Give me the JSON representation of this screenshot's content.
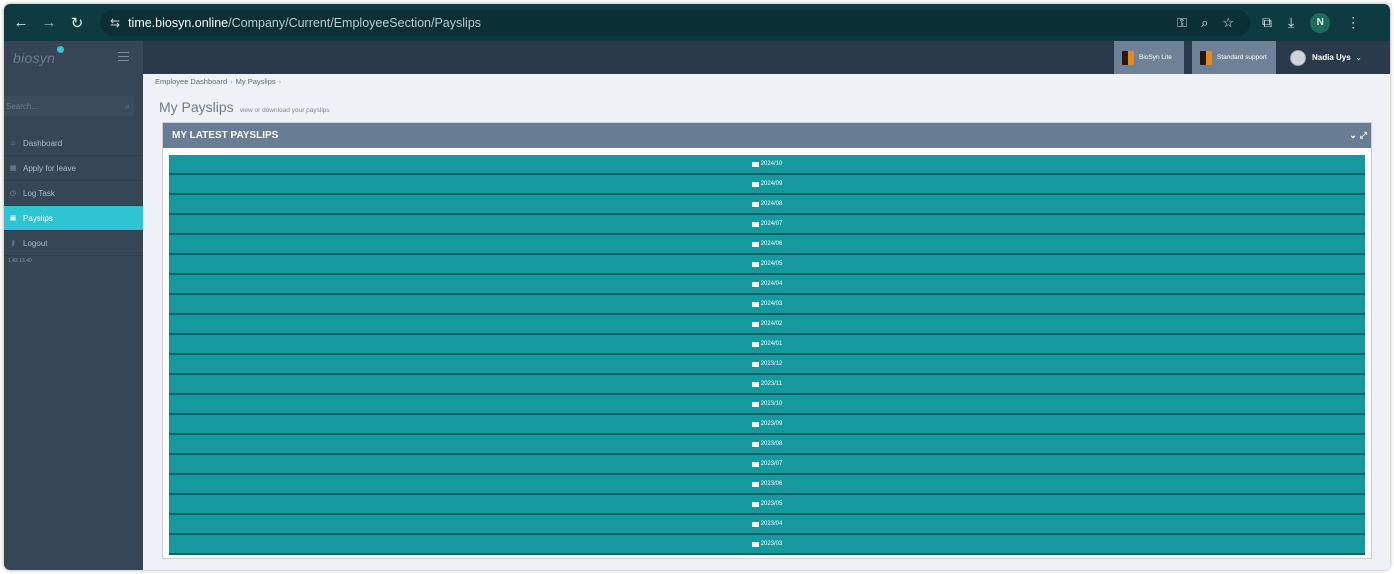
{
  "browser": {
    "url_host": "time.biosyn.online",
    "url_path": "/Company/Current/EmployeeSection/Payslips",
    "profile_initial": "N"
  },
  "header": {
    "logo": "biosyn",
    "buttons": [
      "BioSyn Lite",
      "Standard support"
    ],
    "user_name": "Nadia Uys"
  },
  "sidebar": {
    "search_placeholder": "Search...",
    "items": [
      {
        "label": "Dashboard",
        "icon": "home-icon"
      },
      {
        "label": "Apply for leave",
        "icon": "calendar-icon"
      },
      {
        "label": "Log Task",
        "icon": "clock-icon"
      },
      {
        "label": "Payslips",
        "icon": "payslip-icon",
        "active": true
      },
      {
        "label": "Logout",
        "icon": "key-icon"
      }
    ],
    "version": "1.42.13.40"
  },
  "main": {
    "breadcrumb": [
      "Employee Dashboard",
      "My Payslips"
    ],
    "title": "My Payslips",
    "subtitle": "view or download your payslips",
    "panel_title": "MY LATEST PAYSLIPS",
    "payslips": [
      "2024/10",
      "2024/09",
      "2024/08",
      "2024/07",
      "2024/06",
      "2024/05",
      "2024/04",
      "2024/03",
      "2024/02",
      "2024/01",
      "2023/12",
      "2023/11",
      "2023/10",
      "2023/09",
      "2023/08",
      "2023/07",
      "2023/06",
      "2023/05",
      "2023/04",
      "2023/03"
    ]
  },
  "colors": {
    "accent": "#2ec4d4",
    "payslip_row": "#16989f",
    "panel_header": "#687c94",
    "sidebar": "#364656"
  }
}
